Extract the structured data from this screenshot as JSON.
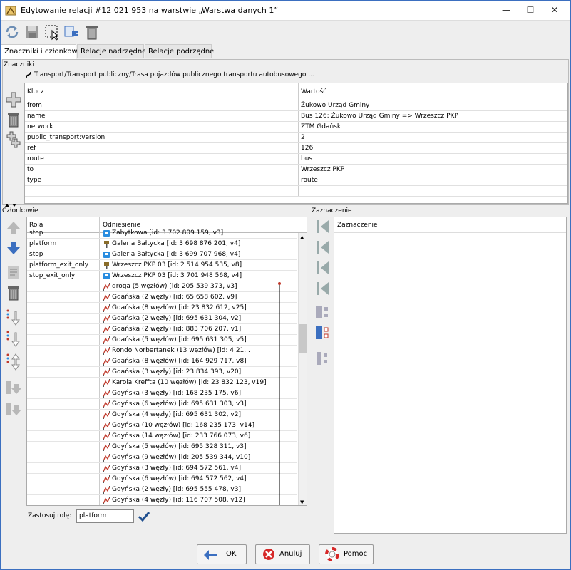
{
  "window": {
    "title": "Edytowanie relacji #12 021 953 na warstwie „Warstwa danych 1”",
    "minimize_glyph": "—",
    "maximize_glyph": "☐",
    "close_glyph": "✕"
  },
  "tabs": [
    {
      "label": "Znaczniki i członkowie",
      "active": true
    },
    {
      "label": "Relacje nadrzędne",
      "active": false
    },
    {
      "label": "Relacje podrzędne",
      "active": false
    }
  ],
  "tags": {
    "section_label": "Znaczniki",
    "preset": "Transport/Transport publiczny/Trasa pojazdów publicznego transportu autobusowego ...",
    "headers": {
      "key": "Klucz",
      "value": "Wartość"
    },
    "rows": [
      {
        "key": "from",
        "value": "Żukowo Urząd Gminy"
      },
      {
        "key": "name",
        "value": "Bus 126: Żukowo Urząd Gminy => Wrzeszcz PKP"
      },
      {
        "key": "network",
        "value": "ZTM Gdańsk"
      },
      {
        "key": "public_transport:version",
        "value": "2"
      },
      {
        "key": "ref",
        "value": "126"
      },
      {
        "key": "route",
        "value": "bus"
      },
      {
        "key": "to",
        "value": "Wrzeszcz PKP"
      },
      {
        "key": "type",
        "value": "route"
      },
      {
        "key": "",
        "value": ""
      }
    ]
  },
  "members": {
    "section_label": "Członkowie",
    "headers": {
      "role": "Rola",
      "ref": "Odniesienie"
    },
    "rows": [
      {
        "role": "stop",
        "ref": "Zabytkowa [id: 3 702 809 159, v3]",
        "kind": "stop"
      },
      {
        "role": "platform",
        "ref": "Galeria Bałtycka [id: 3 698 876 201, v4]",
        "kind": "platform"
      },
      {
        "role": "stop",
        "ref": "Galeria Bałtycka [id: 3 699 707 968, v4]",
        "kind": "stop"
      },
      {
        "role": "platform_exit_only",
        "ref": "Wrzeszcz PKP 03 [id: 2 514 954 535, v8]",
        "kind": "platform"
      },
      {
        "role": "stop_exit_only",
        "ref": "Wrzeszcz PKP 03 [id: 3 701 948 568, v4]",
        "kind": "stop"
      },
      {
        "role": "",
        "ref": "droga (5 węzłów) [id: 205 539 373, v3]",
        "kind": "way"
      },
      {
        "role": "",
        "ref": "Gdańska (2 węzły) [id: 65 658 602, v9]",
        "kind": "way"
      },
      {
        "role": "",
        "ref": "Gdańska (8 węzłów) [id: 23 832 612, v25]",
        "kind": "way"
      },
      {
        "role": "",
        "ref": "Gdańska (2 węzły) [id: 695 631 304, v2]",
        "kind": "way"
      },
      {
        "role": "",
        "ref": "Gdańska (2 węzły) [id: 883 706 207, v1]",
        "kind": "way"
      },
      {
        "role": "",
        "ref": "Gdańska (5 węzłów) [id: 695 631 305, v5]",
        "kind": "way"
      },
      {
        "role": "",
        "ref": "Rondo Norbertanek (13 węzłów) [id: 4 21...",
        "kind": "way"
      },
      {
        "role": "",
        "ref": "Gdańska (8 węzłów) [id: 164 929 717, v8]",
        "kind": "way"
      },
      {
        "role": "",
        "ref": "Gdańska (3 węzły) [id: 23 834 393, v20]",
        "kind": "way"
      },
      {
        "role": "",
        "ref": "Karola Kreffta (10 węzłów) [id: 23 832 123, v19]",
        "kind": "way"
      },
      {
        "role": "",
        "ref": "Gdyńska (3 węzły) [id: 168 235 175, v6]",
        "kind": "way"
      },
      {
        "role": "",
        "ref": "Gdyńska (6 węzłów) [id: 695 631 303, v3]",
        "kind": "way"
      },
      {
        "role": "",
        "ref": "Gdyńska (4 węzły) [id: 695 631 302, v2]",
        "kind": "way"
      },
      {
        "role": "",
        "ref": "Gdyńska (10 węzłów) [id: 168 235 173, v14]",
        "kind": "way"
      },
      {
        "role": "",
        "ref": "Gdyńska (14 węzłów) [id: 233 766 073, v6]",
        "kind": "way"
      },
      {
        "role": "",
        "ref": "Gdyńska (5 węzłów) [id: 695 328 311, v3]",
        "kind": "way"
      },
      {
        "role": "",
        "ref": "Gdyńska (9 węzłów) [id: 205 539 344, v10]",
        "kind": "way"
      },
      {
        "role": "",
        "ref": "Gdyńska (3 węzły) [id: 694 572 561, v4]",
        "kind": "way"
      },
      {
        "role": "",
        "ref": "Gdyńska (6 węzłów) [id: 694 572 562, v4]",
        "kind": "way"
      },
      {
        "role": "",
        "ref": "Gdyńska (2 węzły) [id: 695 555 478, v3]",
        "kind": "way"
      },
      {
        "role": "",
        "ref": "Gdyńska (4 węzły) [id: 116 707 508, v12]",
        "kind": "way"
      }
    ],
    "apply_role_label": "Zastosuj rolę:",
    "apply_role_value": "platform"
  },
  "selection": {
    "section_label": "Zaznaczenie",
    "header": "Zaznaczenie"
  },
  "buttons": {
    "ok": "OK",
    "cancel": "Anuluj",
    "help": "Pomoc"
  },
  "colors": {
    "accent": "#3b6fc0",
    "way_icon": "#c0392b",
    "stop_icon": "#2a8de0"
  }
}
